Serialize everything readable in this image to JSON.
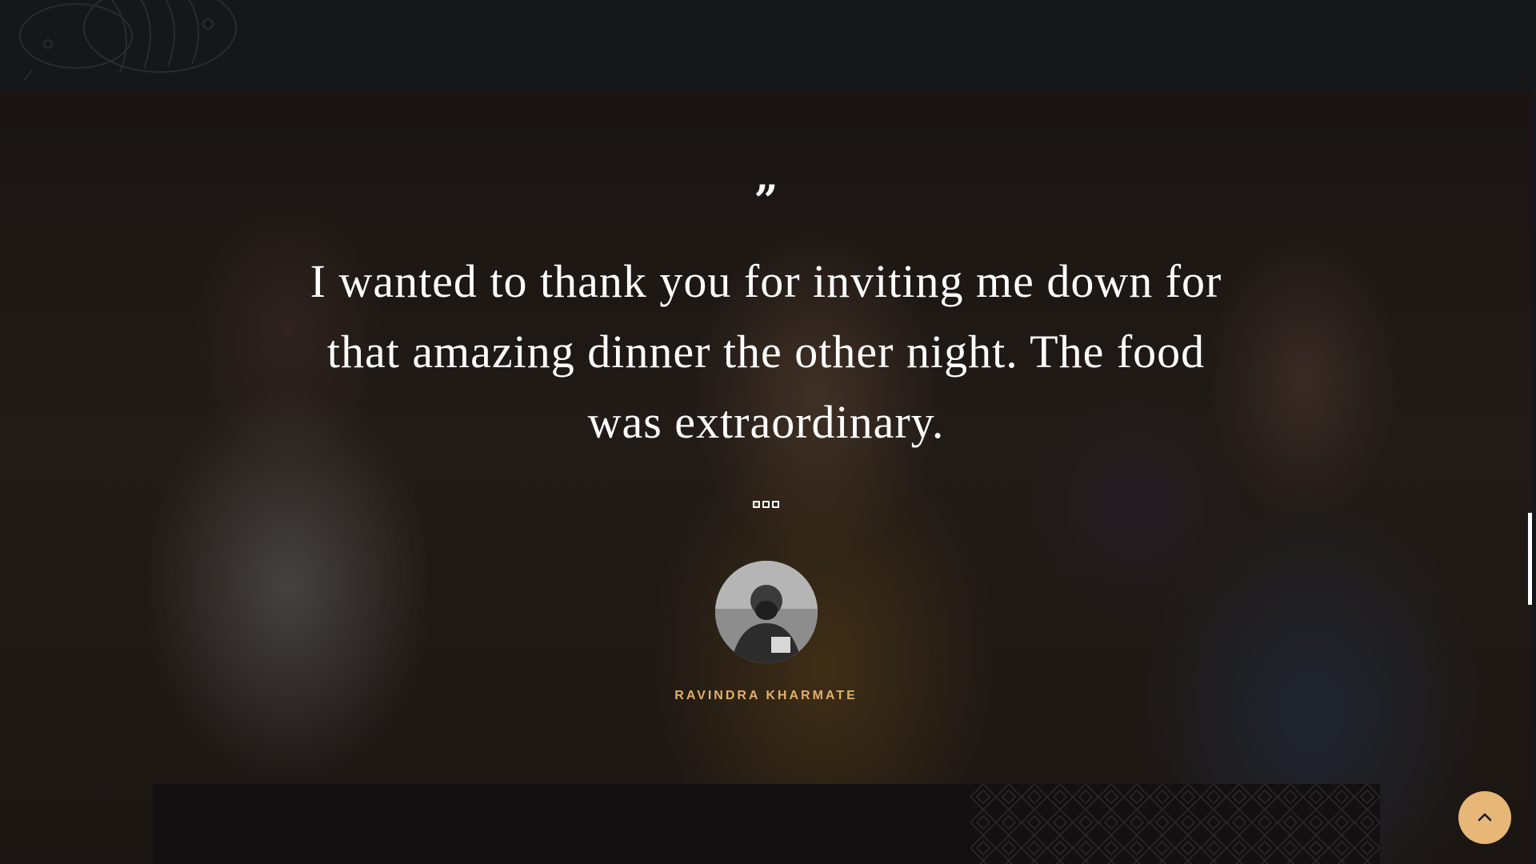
{
  "testimonial": {
    "quote_mark": "”",
    "text": "I wanted to thank you for inviting me down for that amazing dinner the other night. The food was extraordinary.",
    "author": "RAVINDRA KHARMATE",
    "avatar_icon": "person-avatar-icon",
    "dots_count": 3,
    "active_dot": 0
  },
  "back_to_top": {
    "icon": "chevron-up-icon"
  },
  "colors": {
    "accent": "#e1b06a",
    "back_to_top_bg": "#e6b777",
    "dark_bg": "#16171a",
    "card_bg": "#121010"
  }
}
